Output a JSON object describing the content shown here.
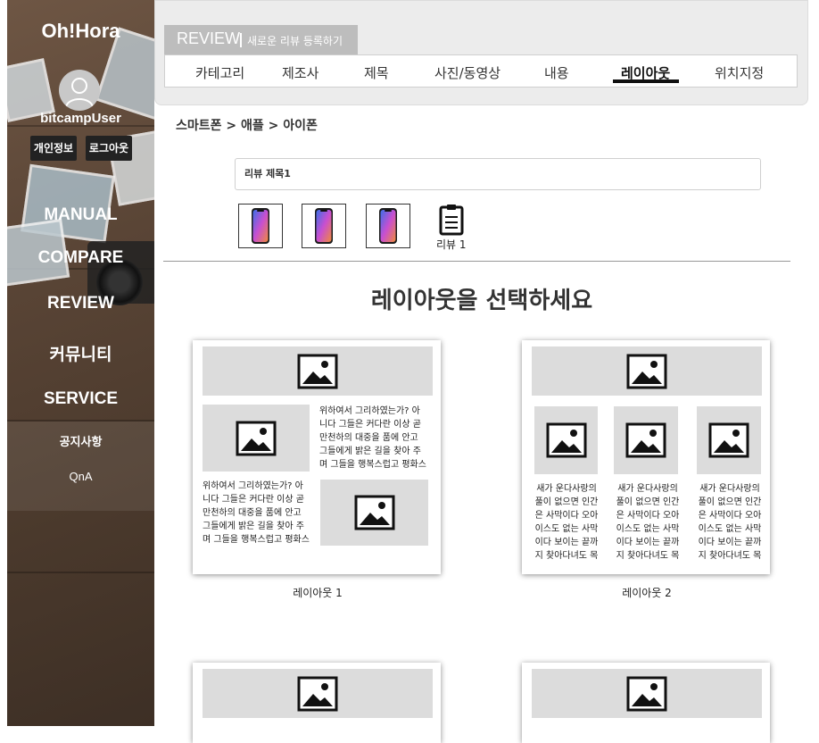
{
  "sidebar": {
    "logo": "Oh!Hora",
    "username": "bitcampUser",
    "buttons": {
      "profile": "개인정보",
      "logout": "로그아웃"
    },
    "nav": [
      "MANUAL",
      "COMPARE",
      "REVIEW",
      "커뮤니티",
      "SERVICE"
    ],
    "subnav": [
      "공지사항",
      "QnA"
    ]
  },
  "header": {
    "review_label": "REVIEW",
    "review_sub": "새로운 리뷰 등록하기",
    "tabs": [
      "카테고리",
      "제조사",
      "제목",
      "사진/동영상",
      "내용",
      "레이아웃",
      "위치지정"
    ],
    "active_tab": "레이아웃"
  },
  "breadcrumb": "스마트폰 > 애플 > 아이폰",
  "review_title": "리뷰 제목1",
  "clip_label": "리뷰 1",
  "choose_title": "레이아웃을 선택하세요",
  "sample_text_long": "위하여서 그리하였는가? 아니다 그들은 커다란 이상 곧 만천하의 대중을 품에 안고 그들에게 밝은 길을 찾아 주며 그들을 행복스럽고 평화스러운 곳으로 인도하겠다는 커다란",
  "sample_text_short": "새가 운다사랑의 풀이 없으면 인간은 사막이다 오아이스도 없는 사막이다 보이는 끝까지 찾아다녀도 목",
  "layouts": [
    {
      "label": "레이아웃 1"
    },
    {
      "label": "레이아웃 2"
    }
  ]
}
